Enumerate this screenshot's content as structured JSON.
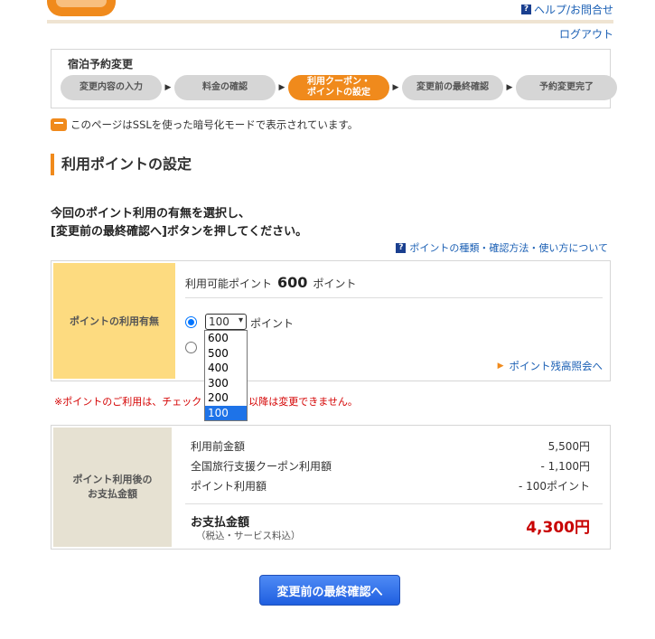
{
  "header": {
    "help_label": "ヘルプ/お問合せ",
    "logout_label": "ログアウト"
  },
  "steps": {
    "title": "宿泊予約変更",
    "items": [
      {
        "label": "変更内容の入力"
      },
      {
        "label": "料金の確認"
      },
      {
        "label": "利用クーポン・\nポイントの設定"
      },
      {
        "label": "変更前の最終確認"
      },
      {
        "label": "予約変更完了"
      }
    ],
    "active_index": 2
  },
  "ssl_notice": "このページはSSLを使った暗号化モードで表示されています。",
  "section_title": "利用ポイントの設定",
  "instruction": {
    "line1": "今回のポイント利用の有無を選択し、",
    "line2": "[変更前の最終確認へ]ボタンを押してください。"
  },
  "point_help_link": "ポイントの種類・確認方法・使い方について",
  "points": {
    "label": "ポイントの利用有無",
    "available_prefix": "利用可能ポイント",
    "available_value": "600",
    "available_suffix": "ポイント",
    "selected_value": "100",
    "unit": "ポイント",
    "options": [
      "600",
      "500",
      "400",
      "300",
      "200",
      "100"
    ],
    "balance_link": "ポイント残高照会へ"
  },
  "warning": "※ポイントのご利用は、チェック",
  "warning_tail": "以降は変更できません。",
  "payment": {
    "label_line1": "ポイント利用後の",
    "label_line2": "お支払金額",
    "rows": [
      {
        "label": "利用前金額",
        "value": "5,500円"
      },
      {
        "label": "全国旅行支援クーポン利用額",
        "value": "- 1,100円"
      },
      {
        "label": "ポイント利用額",
        "value": "- 100ポイント"
      }
    ],
    "total_label": "お支払金額",
    "total_sub": "（税込・サービス料込）",
    "total_value": "4,300円"
  },
  "submit_button": "変更前の最終確認へ",
  "colors": {
    "accent": "#f08a1c",
    "link": "#1a5fb4",
    "warning": "#d40000",
    "total": "#c80000",
    "button": "#1f5fe0"
  }
}
